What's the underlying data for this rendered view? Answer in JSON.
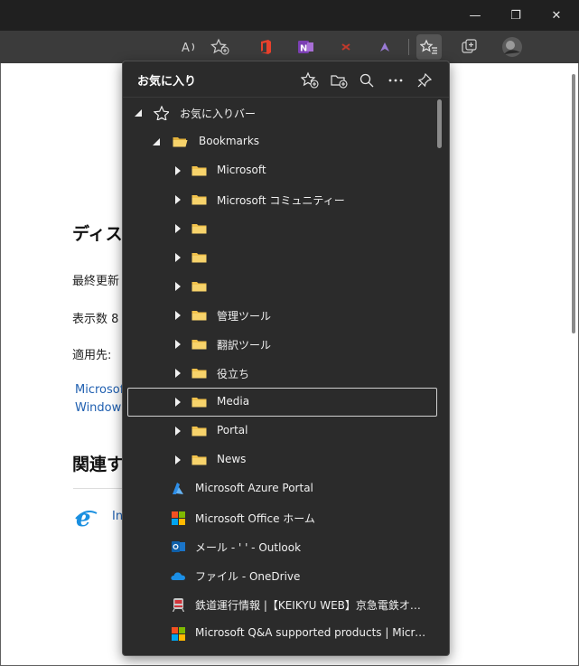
{
  "browser": {
    "window_controls": {
      "minimize": "—",
      "maximize": "❐",
      "close": "✕"
    },
    "toolbar_icons": [
      "read-aloud-icon",
      "add-favorite-icon",
      "office-extension-icon",
      "onenote-extension-icon",
      "extension-icon",
      "extension-icon",
      "favorites-icon",
      "collections-icon",
      "profile-avatar"
    ]
  },
  "page": {
    "heading1": "ディス",
    "line1": "最終更新",
    "line2": "表示数 8",
    "line3": "適用先:",
    "link1": "Microsof",
    "link2": "Windows",
    "heading2": "関連す",
    "link3": "In"
  },
  "favorites": {
    "title": "お気に入り",
    "items": [
      {
        "label": "お気に入りバー",
        "type": "root"
      },
      {
        "label": "Bookmarks",
        "type": "folder-open"
      },
      {
        "label": "Microsoft",
        "type": "folder"
      },
      {
        "label": "Microsoft コミュニティー",
        "type": "folder"
      },
      {
        "label": "",
        "type": "folder"
      },
      {
        "label": "",
        "type": "folder"
      },
      {
        "label": "",
        "type": "folder"
      },
      {
        "label": "管理ツール",
        "type": "folder"
      },
      {
        "label": "翻訳ツール",
        "type": "folder"
      },
      {
        "label": "役立ち",
        "type": "folder"
      },
      {
        "label": "Media",
        "type": "folder",
        "selected": true
      },
      {
        "label": "Portal",
        "type": "folder"
      },
      {
        "label": "News",
        "type": "folder"
      },
      {
        "label": "Microsoft Azure Portal",
        "type": "azure"
      },
      {
        "label": "Microsoft Office ホーム",
        "type": "ms"
      },
      {
        "label": "メール - ' ' - Outlook",
        "type": "outlook"
      },
      {
        "label": "ファイル - OneDrive",
        "type": "onedrive"
      },
      {
        "label": "鉄道運行情報 |【KEIKYU WEB】京急電鉄オフィシャ...",
        "type": "train"
      },
      {
        "label": "Microsoft Q&A supported products | Microsoft ...",
        "type": "ms"
      }
    ]
  }
}
